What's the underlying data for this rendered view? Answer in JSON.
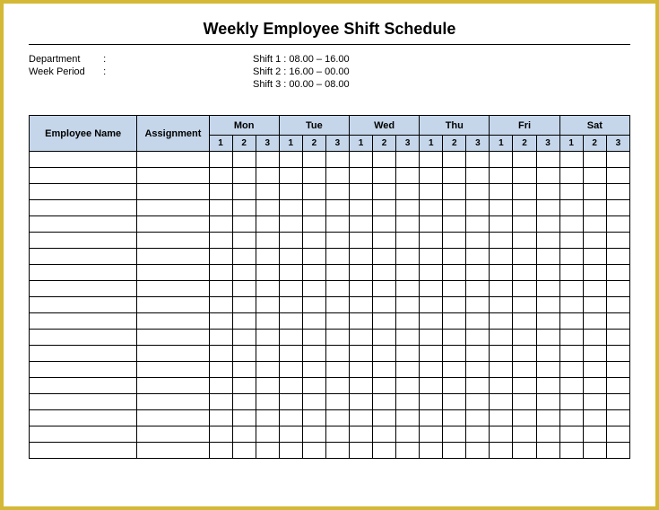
{
  "title": "Weekly Employee Shift Schedule",
  "meta": {
    "department_label": "Department",
    "week_period_label": "Week Period",
    "colon": ":",
    "shift1": "Shift 1 : 08.00 – 16.00",
    "shift2": "Shift 2 : 16.00 – 00.00",
    "shift3": "Shift 3 : 00.00 – 08.00"
  },
  "headers": {
    "employee_name": "Employee Name",
    "assignment": "Assignment",
    "days": [
      "Mon",
      "Tue",
      "Wed",
      "Thu",
      "Fri",
      "Sat"
    ],
    "shifts": [
      "1",
      "2",
      "3"
    ]
  },
  "row_count": 19
}
